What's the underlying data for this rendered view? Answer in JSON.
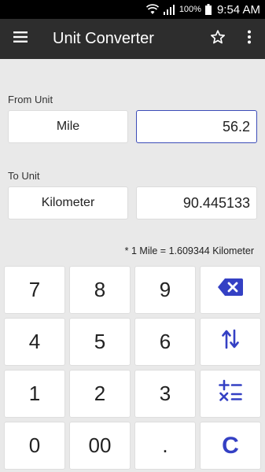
{
  "status_bar": {
    "battery": "100%",
    "time": "9:54 AM"
  },
  "app_bar": {
    "title": "Unit Converter"
  },
  "from": {
    "label": "From Unit",
    "unit": "Mile",
    "value": "56.2"
  },
  "to": {
    "label": "To Unit",
    "unit": "Kilometer",
    "value": "90.445133"
  },
  "conversion_note": "* 1 Mile = 1.609344 Kilometer",
  "keypad": {
    "k7": "7",
    "k8": "8",
    "k9": "9",
    "k4": "4",
    "k5": "5",
    "k6": "6",
    "k1": "1",
    "k2": "2",
    "k3": "3",
    "k0": "0",
    "k00": "00",
    "kdot": ".",
    "clear": "C"
  },
  "icons": {
    "backspace": "backspace-icon",
    "swap": "swap-icon",
    "calculator": "calculator-icon",
    "menu": "menu-icon",
    "star": "star-icon",
    "more": "more-vert-icon"
  },
  "colors": {
    "accent": "#3440c4",
    "app_bar": "#2d2d2d",
    "background": "#e9e9e9"
  }
}
